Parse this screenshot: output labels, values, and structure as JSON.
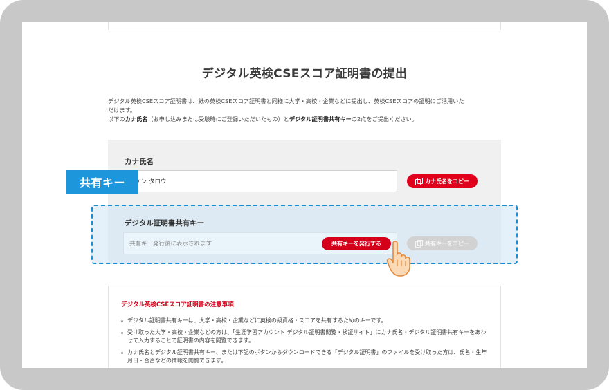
{
  "page": {
    "title": "デジタル英検CSEスコア証明書の提出",
    "intro_line1": "デジタル英検CSEスコア証明書は、紙の英検CSEスコア証明書と同様に大学・高校・企業などに提出し、英検CSEスコアの証明にご活用いた",
    "intro_line2": "だけます。",
    "intro_line3_pre": "以下の",
    "intro_line3_b1": "カナ氏名",
    "intro_line3_mid": "（お申し込みまたは受験時にご登録いただいたもの）と",
    "intro_line3_b2": "デジタル証明書共有キー",
    "intro_line3_post": "の2点をご提出ください。"
  },
  "kana_name": {
    "label": "カナ氏名",
    "value": "イケン タロウ",
    "copy_label": "カナ氏名をコピー"
  },
  "share_key": {
    "label": "デジタル証明書共有キー",
    "placeholder": "共有キー発行後に表示されます",
    "issue_label": "共有キーを発行する",
    "copy_label": "共有キーをコピー"
  },
  "callout": {
    "label": "共有キー"
  },
  "notes": {
    "title": "デジタル英検CSEスコア証明書の注意事項",
    "items": [
      "デジタル証明書共有キーは、大学・高校・企業などに英検の級資格・スコアを共有するためのキーです。",
      "受け取った大学・高校・企業などの方は、「生涯学習アカウント デジタル証明書閲覧・検証サイト」にカナ氏名・デジタル証明書共有キーをあわせて入力することで証明書の内容を閲覧できます。",
      "カナ氏名とデジタル証明書共有キー、または下記のボタンからダウンロードできる「デジタル証明書」のファイルを受け取った方は、氏名・生年月日・合否などの情報を閲覧できます。"
    ]
  },
  "colors": {
    "accent_red": "#e0001b",
    "highlight_blue": "#1e96dc"
  },
  "icons": {
    "copy": "copy-icon",
    "pointer": "hand-pointer-icon"
  }
}
